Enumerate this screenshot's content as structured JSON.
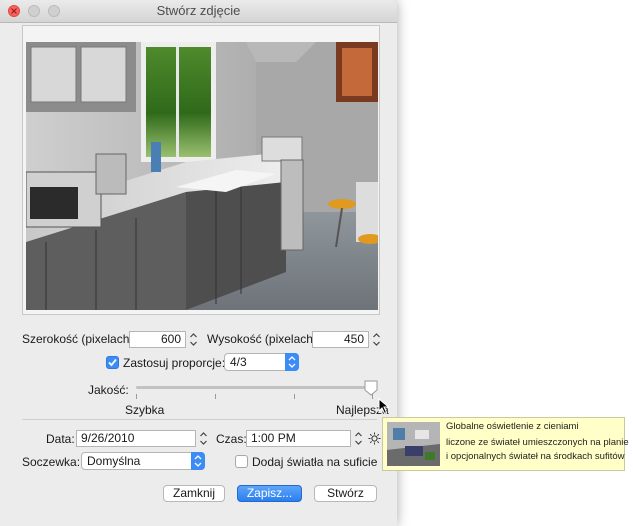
{
  "window": {
    "title": "Stwórz zdjęcie"
  },
  "size": {
    "width_label": "Szerokość (pixelach):",
    "width_value": "600",
    "height_label": "Wysokość (pixelach):",
    "height_value": "450"
  },
  "proportions": {
    "label": "Zastosuj proporcje:",
    "checked": true,
    "value": "4/3"
  },
  "quality": {
    "label": "Jakość:",
    "min_label": "Szybka",
    "max_label": "Najlepsza",
    "level": 1.0
  },
  "datetime": {
    "date_label": "Data:",
    "date_value": "9/26/2010",
    "time_label": "Czas:",
    "time_value": "1:00 PM"
  },
  "lens": {
    "label": "Soczewka:",
    "value": "Domyślna"
  },
  "ceiling_lights": {
    "label": "Dodaj światła na suficie",
    "checked": false
  },
  "buttons": {
    "close": "Zamknij",
    "save": "Zapisz...",
    "create": "Stwórz"
  },
  "tooltip": {
    "line1": "Globalne oświetlenie z cieniami",
    "line2": "liczone ze świateł umieszczonych na planie",
    "line3": "i opcjonalnych świateł na środkach sufitów"
  },
  "icons": {
    "sun": "sun-icon",
    "cursor": "pointer-cursor-icon"
  },
  "colors": {
    "accent": "#3b8cf5",
    "close_button": "#fc605c",
    "tooltip_bg": "#ffffc7"
  }
}
